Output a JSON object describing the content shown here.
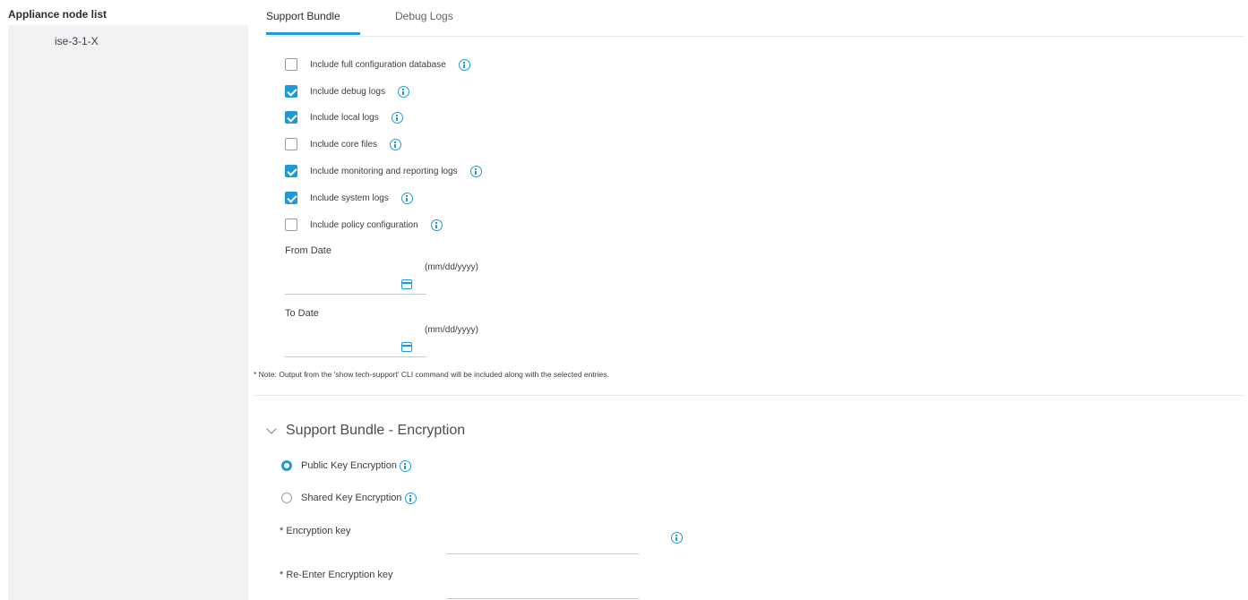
{
  "sidebar": {
    "title": "Appliance node list",
    "nodes": [
      {
        "label": "ise-3-1-X"
      }
    ]
  },
  "tabs": [
    {
      "label": "Support Bundle",
      "active": true
    },
    {
      "label": "Debug Logs",
      "active": false
    }
  ],
  "options": [
    {
      "label": "Include full configuration database",
      "checked": false
    },
    {
      "label": "Include debug logs",
      "checked": true
    },
    {
      "label": "Include local logs",
      "checked": true
    },
    {
      "label": "Include core files",
      "checked": false
    },
    {
      "label": "Include monitoring and reporting logs",
      "checked": true
    },
    {
      "label": "Include system logs",
      "checked": true
    },
    {
      "label": "Include policy configuration",
      "checked": false
    }
  ],
  "from_date": {
    "label": "From Date",
    "value": "",
    "format": "(mm/dd/yyyy)"
  },
  "to_date": {
    "label": "To Date",
    "value": "",
    "format": "(mm/dd/yyyy)"
  },
  "note": "* Note: Output from the 'show tech-support' CLI command will be included along with the selected entries.",
  "encryption": {
    "title": "Support Bundle - Encryption",
    "options": [
      {
        "label": "Public Key Encryption",
        "selected": true
      },
      {
        "label": "Shared Key Encryption",
        "selected": false
      }
    ],
    "key_label": "* Encryption key",
    "key_value": "",
    "reenter_label": "* Re-Enter Encryption key",
    "reenter_value": ""
  },
  "colors": {
    "accent": "#1f9ad6",
    "sidebar_bg": "#f1f2f3"
  },
  "icons": {
    "info": "info-icon",
    "calendar": "calendar-icon",
    "chevron": "chevron-down-icon"
  }
}
